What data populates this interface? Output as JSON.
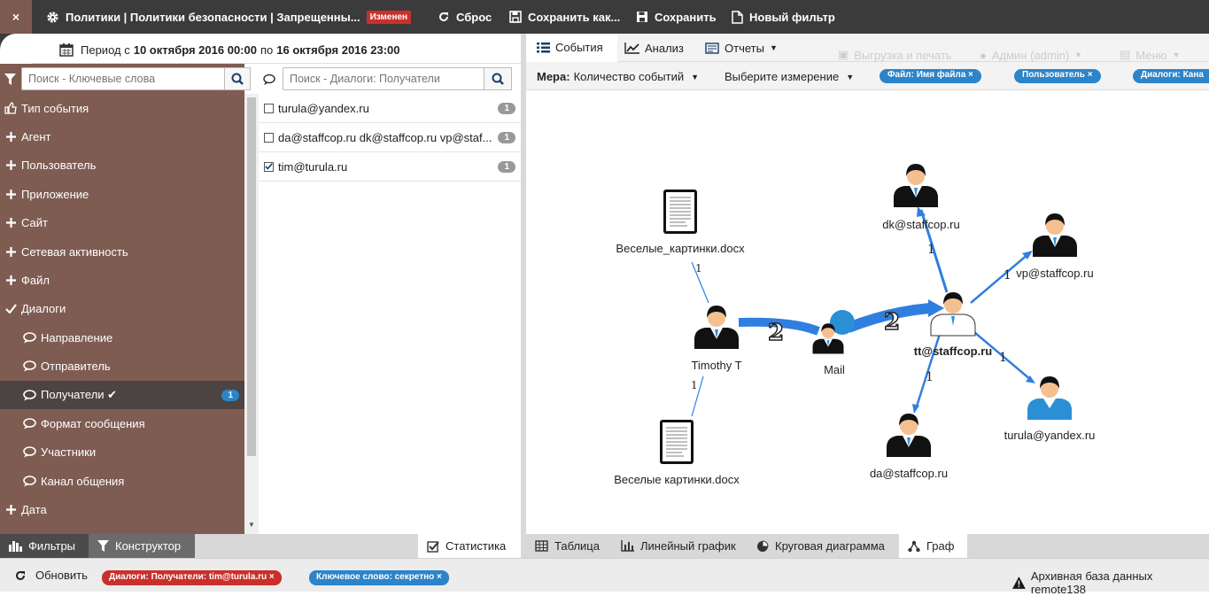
{
  "topbar": {
    "close": "×",
    "title": "Политики | Политики безопасности | Запрещенны...",
    "modified_badge": "Изменен",
    "reset": "Сброс",
    "save_as": "Сохранить как...",
    "save": "Сохранить",
    "new_filter": "Новый фильтр"
  },
  "period": {
    "prefix": "Период с",
    "from": "10 октября 2016 00:00",
    "mid": "по",
    "to": "16 октября 2016 23:00"
  },
  "sidebar": {
    "search_placeholder": "Поиск - Ключевые слова",
    "items": [
      {
        "label": "Тип события",
        "icon": "thumbs-up-icon",
        "type": "top"
      },
      {
        "label": "Агент",
        "icon": "plus-icon",
        "type": "top"
      },
      {
        "label": "Пользователь",
        "icon": "plus-icon",
        "type": "top"
      },
      {
        "label": "Приложение",
        "icon": "plus-icon",
        "type": "top"
      },
      {
        "label": "Сайт",
        "icon": "plus-icon",
        "type": "top"
      },
      {
        "label": "Сетевая активность",
        "icon": "plus-icon",
        "type": "top"
      },
      {
        "label": "Файл",
        "icon": "plus-icon",
        "type": "top"
      },
      {
        "label": "Диалоги",
        "icon": "check-icon",
        "type": "top"
      },
      {
        "label": "Направление",
        "icon": "chat-icon",
        "type": "sub"
      },
      {
        "label": "Отправитель",
        "icon": "chat-icon",
        "type": "sub"
      },
      {
        "label": "Получатели ✔",
        "icon": "chat-icon",
        "type": "sub",
        "active": true,
        "count": "1"
      },
      {
        "label": "Формат сообщения",
        "icon": "chat-icon",
        "type": "sub"
      },
      {
        "label": "Участники",
        "icon": "chat-icon",
        "type": "sub"
      },
      {
        "label": "Канал общения",
        "icon": "chat-icon",
        "type": "sub"
      },
      {
        "label": "Дата",
        "icon": "plus-icon",
        "type": "top"
      }
    ]
  },
  "list": {
    "search_placeholder": "Поиск - Диалоги: Получатели",
    "rows": [
      {
        "label": "turula@yandex.ru",
        "count": "1",
        "checked": false
      },
      {
        "label": "da@staffcop.ru dk@staffcop.ru vp@staf...",
        "count": "1",
        "checked": false
      },
      {
        "label": "tim@turula.ru",
        "count": "1",
        "checked": true
      }
    ]
  },
  "tabs_top": {
    "events": "События",
    "analysis": "Анализ",
    "reports": "Отчеты",
    "export_print": "Выгрузка и печать",
    "admin": "Админ (admin)",
    "menu": "Меню"
  },
  "measure": {
    "label": "Мера:",
    "value": "Количество событий",
    "dimension": "Выберите измерение",
    "chips": [
      "Файл: Имя файла ×",
      "Пользователь ×",
      "Диалоги: Кана"
    ]
  },
  "graph": {
    "nodes": {
      "doc1": "Веселые_картинки.docx",
      "doc2": "Веселые картинки.docx",
      "timothy": "Timothy T",
      "mail": "Mail",
      "tt": "tt@staffcop.ru",
      "dk": "dk@staffcop.ru",
      "vp": "vp@staffcop.ru",
      "turula": "turula@yandex.ru",
      "da": "da@staffcop.ru"
    },
    "edges": {
      "doc1_timothy": "1",
      "doc2_timothy": "1",
      "timothy_mail": "2",
      "mail_tt": "2",
      "tt_dk": "1",
      "tt_vp": "1",
      "tt_turula": "1",
      "tt_da": "1"
    },
    "colors": {
      "edge": "#2f7fe0",
      "person_dark": "#111111",
      "person_blue": "#2b8fd6"
    }
  },
  "bottom_left": {
    "filters": "Фильтры",
    "constructor": "Конструктор",
    "statistics": "Статистика"
  },
  "bottom_right": {
    "table": "Таблица",
    "line_chart": "Линейный график",
    "pie_chart": "Круговая диаграмма",
    "graph": "Граф"
  },
  "status": {
    "refresh": "Обновить",
    "chip1": "Диалоги: Получатели: tim@turula.ru ×",
    "chip2": "Ключевое слово: секретно ×",
    "archive": "Архивная база данных remote138"
  }
}
